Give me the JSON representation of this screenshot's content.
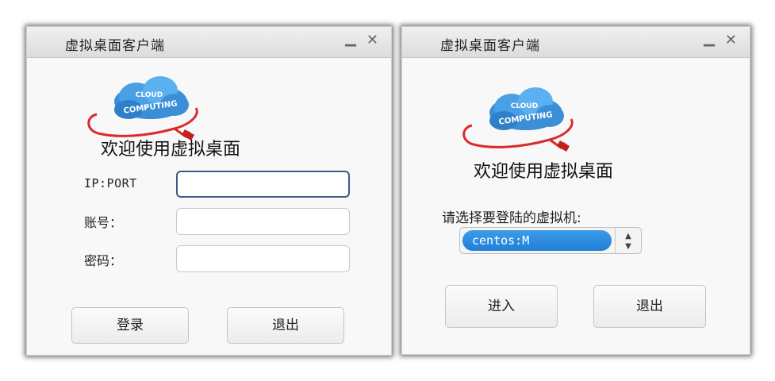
{
  "login_window": {
    "title": "虚拟桌面客户端",
    "welcome": "欢迎使用虚拟桌面",
    "logo_text_line1": "CLOUD",
    "logo_text_line2": "COMPUTING",
    "ip_label": "IP:PORT",
    "ip_value": "",
    "account_label": "账号：",
    "account_value": "",
    "password_label": "密码：",
    "password_value": "",
    "login_button": "登录",
    "exit_button": "退出"
  },
  "select_window": {
    "title": "虚拟桌面客户端",
    "welcome": "欢迎使用虚拟桌面",
    "logo_text_line1": "CLOUD",
    "logo_text_line2": "COMPUTING",
    "select_label": "请选择要登陆的虚拟机:",
    "selected_vm": "centos:M",
    "enter_button": "进入",
    "exit_button": "退出"
  },
  "icons": {
    "minimize": "minimize-icon",
    "close": "close-icon",
    "spinner_up": "triangle-up-icon",
    "spinner_down": "triangle-down-icon"
  },
  "colors": {
    "selection_blue": "#1f7fd8",
    "focus_border": "#3c5a86",
    "cable_red": "#d92b2b",
    "cloud_blue": "#3a8fd6"
  }
}
